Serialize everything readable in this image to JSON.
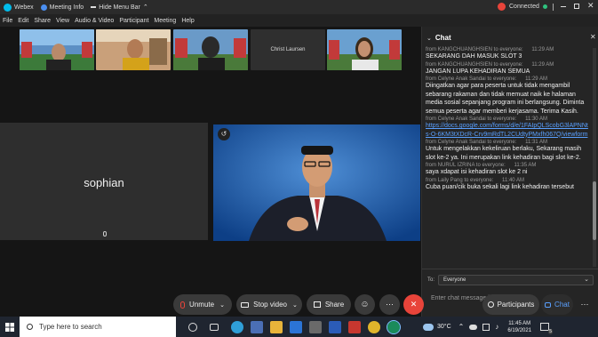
{
  "window": {
    "app_name": "Webex",
    "meeting_info": "Meeting Info",
    "hide_menu": "Hide Menu Bar",
    "status": "Connected"
  },
  "menu": [
    "File",
    "Edit",
    "Share",
    "View",
    "Audio & Video",
    "Participant",
    "Meeting",
    "Help"
  ],
  "participants": {
    "thumb_name_4": "Christ Laursen",
    "big_name": "sophian"
  },
  "chat": {
    "title": "Chat",
    "messages": [
      {
        "meta": "from KANGCHUANGHSIEN to everyone:",
        "time": "11:29 AM",
        "text": "SEKARANG DAH MASUK SLOT 3"
      },
      {
        "meta": "from KANGCHUANGHSIEN to everyone:",
        "time": "11:29 AM",
        "text": "JANGAN LUPA KEHADIRAN SEMUA"
      },
      {
        "meta": "from Celyne Anak Sandai to everyone:",
        "time": "11:29 AM",
        "text": "Diingatkan  agar para peserta untuk tidak mengambil sebarang rakaman dan tidak memuat naik ke halaman media sosial sepanjang program ini berlangsung. Diminta semua peserta  agar memberi kerjasama. Terima Kasih."
      },
      {
        "meta": "from Celyne Anak Sandai to everyone:",
        "time": "11:30 AM",
        "link": "https://docs.google.com/forms/d/e/1FAIpQLScobG3lAPNNts-O-6KM3tXDcR-Crv9mRdTL2CUdtyPMxfh067Q/viewform"
      },
      {
        "meta": "from Celyne Anak Sandai to everyone:",
        "time": "11:31 AM",
        "text": "Untuk mengelakkan kekeliruan berlaku, Sekarang masih slot ke-2 ya. Ini merupakan link kehadiran bagi slot ke-2."
      },
      {
        "meta": "from NURUL IZRINA to everyone:",
        "time": "11:35 AM",
        "text": "saya xdapat isi kehadiran slot ke 2 ni"
      },
      {
        "meta": "from Laily Pang to everyone:",
        "time": "11:40 AM",
        "text": "Cuba puan/cik buka sekali lagi link kehadiran tersebut"
      }
    ],
    "to_label": "To:",
    "to_value": "Everyone",
    "input_placeholder": "Enter chat message here"
  },
  "controls": {
    "unmute": "Unmute",
    "stop_video": "Stop video",
    "share": "Share",
    "participants": "Participants",
    "chat": "Chat"
  },
  "taskbar": {
    "search_placeholder": "Type here to search",
    "temperature": "30°C",
    "time": "11:45 AM",
    "date": "6/19/2021",
    "notification_count": "5"
  },
  "colors": {
    "connected": "#2ec27e",
    "end_button": "#e8443a",
    "link": "#5aa0ff",
    "webex_logo": "#00bceb"
  }
}
